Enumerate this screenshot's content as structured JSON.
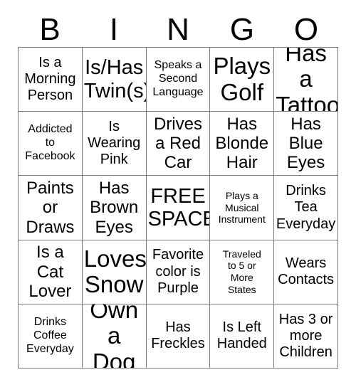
{
  "card": {
    "title_letters": [
      "B",
      "I",
      "N",
      "G",
      "O"
    ],
    "colors": {
      "background": "#ffffff",
      "text": "#000000",
      "grid_line": "#7a7a7a"
    },
    "grid": {
      "rows": 5,
      "columns": 5,
      "free_space_index": 12
    },
    "cells": [
      {
        "text": "Is a\nMorning\nPerson",
        "size": "m"
      },
      {
        "text": "Is/Has\nTwin(s)",
        "size": "xl"
      },
      {
        "text": "Speaks a\nSecond\nLanguage",
        "size": "s"
      },
      {
        "text": "Plays\nGolf",
        "size": "xxl"
      },
      {
        "text": "Has a\nTattoo",
        "size": "xxl"
      },
      {
        "text": "Addicted\nto\nFacebook",
        "size": "s"
      },
      {
        "text": "Is\nWearing\nPink",
        "size": "m"
      },
      {
        "text": "Drives\na Red\nCar",
        "size": "l"
      },
      {
        "text": "Has\nBlonde\nHair",
        "size": "l"
      },
      {
        "text": "Has\nBlue\nEyes",
        "size": "l"
      },
      {
        "text": "Paints\nor\nDraws",
        "size": "l"
      },
      {
        "text": "Has\nBrown\nEyes",
        "size": "l"
      },
      {
        "text": "FREE\nSPACE",
        "size": "xl"
      },
      {
        "text": "Plays a\nMusical\nInstrument",
        "size": "xs"
      },
      {
        "text": "Drinks\nTea\nEveryday",
        "size": "m"
      },
      {
        "text": "Is a\nCat\nLover",
        "size": "l"
      },
      {
        "text": "Loves\nSnow",
        "size": "xxl"
      },
      {
        "text": "Favorite\ncolor is\nPurple",
        "size": "m"
      },
      {
        "text": "Traveled\nto 5 or\nMore\nStates",
        "size": "xs"
      },
      {
        "text": "Wears\nContacts",
        "size": "m"
      },
      {
        "text": "Drinks\nCoffee\nEveryday",
        "size": "s"
      },
      {
        "text": "Own\na Dog",
        "size": "xxl"
      },
      {
        "text": "Has\nFreckles",
        "size": "m"
      },
      {
        "text": "Is Left\nHanded",
        "size": "m"
      },
      {
        "text": "Has 3 or\nmore\nChildren",
        "size": "m"
      }
    ]
  }
}
